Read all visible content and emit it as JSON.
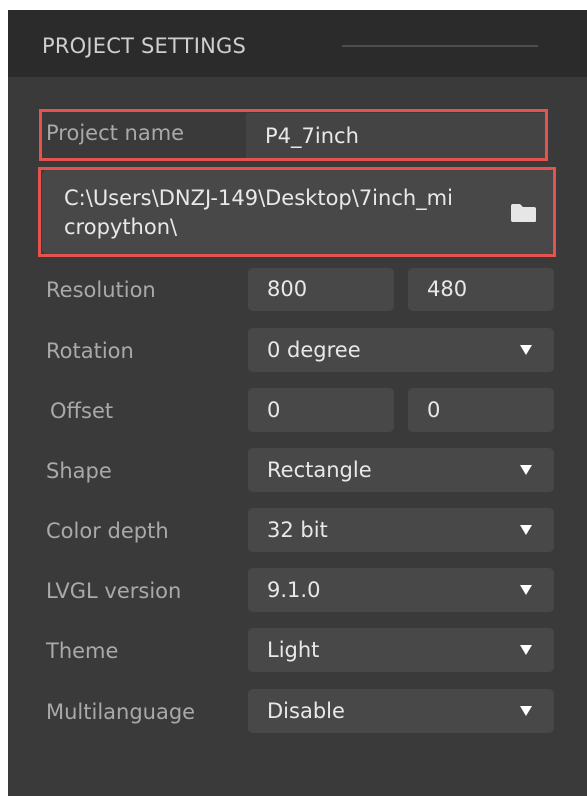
{
  "header": {
    "title": "PROJECT SETTINGS"
  },
  "project_name": {
    "label": "Project name",
    "value": "P4_7inch"
  },
  "path": {
    "line1": "C:\\Users\\DNZJ-149\\Desktop\\7inch_mi",
    "line2": "cropython\\",
    "icon": "folder-icon"
  },
  "resolution": {
    "label": "Resolution",
    "width": "800",
    "height": "480"
  },
  "rotation": {
    "label": "Rotation",
    "value": "0 degree"
  },
  "offset": {
    "label": "Offset",
    "x": "0",
    "y": "0"
  },
  "shape": {
    "label": "Shape",
    "value": "Rectangle"
  },
  "color_depth": {
    "label": "Color depth",
    "value": "32 bit"
  },
  "lvgl_version": {
    "label": "LVGL version",
    "value": "9.1.0"
  },
  "theme": {
    "label": "Theme",
    "value": "Light"
  },
  "multilanguage": {
    "label": "Multilanguage",
    "value": "Disable"
  },
  "colors": {
    "highlight": "#e6534f",
    "panel": "#3a3a3a",
    "field": "#484848",
    "header": "#2b2b2b"
  }
}
